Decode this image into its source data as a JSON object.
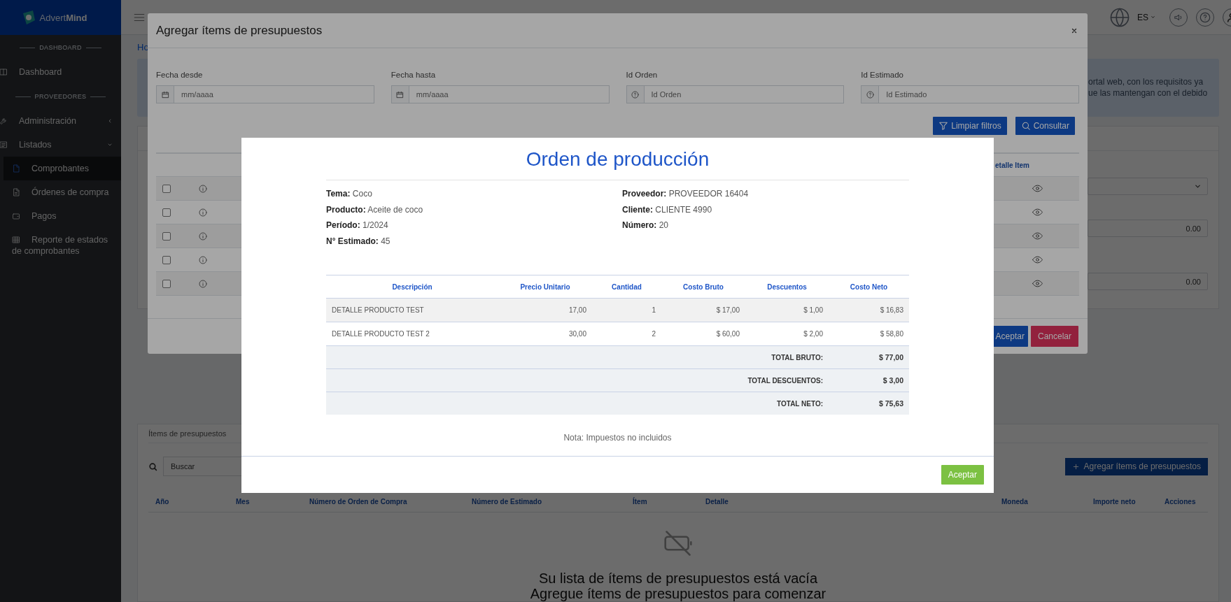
{
  "sidebar": {
    "logo": "Advert**Mind**",
    "items": [
      {
        "kind": "section",
        "label": "DASHBOARD"
      },
      {
        "kind": "link",
        "label": "Dashboard",
        "selected": false
      },
      {
        "kind": "section",
        "label": "PROVEEDORES"
      },
      {
        "kind": "group",
        "label": "Administración",
        "expanded": false
      },
      {
        "kind": "group",
        "label": "Listados",
        "expanded": true,
        "children": [
          {
            "label": "Comprobantes",
            "selected": true
          },
          {
            "label": "Órdenes de compra",
            "selected": false
          },
          {
            "label": "Pagos",
            "selected": false
          },
          {
            "label": "Reporte de estados de comprobantes",
            "selected": false
          }
        ]
      }
    ]
  },
  "topbar": {
    "language": "ES"
  },
  "breadcrumb": "Ho",
  "notice": {
    "lines": [
      "ortal web, con los requisitos ya",
      "ue las mantengan con el debido"
    ]
  },
  "form_card": {
    "fields": [
      {
        "kind": "select"
      },
      {
        "kind": "number",
        "value": "0.00"
      },
      {
        "kind": "number",
        "value": "0.00"
      }
    ]
  },
  "items_card": {
    "title": "Ítems de presupuestos",
    "search": {
      "placeholder": "Buscar"
    },
    "add_button": "Agregar ítems de presupuestos",
    "columns": [
      "Año",
      "Mes",
      "Número de Orden de Compra",
      "Número de Estimado",
      "Ítem",
      "Detalle",
      "Moneda",
      "Importe neto",
      "Acciones"
    ],
    "empty_state": {
      "title": "Su lista de ítems de presupuestos está vacía",
      "subtitle": "Agregue ítems de presupuestos para comenzar"
    }
  },
  "add_items_dialog": {
    "title": "Agregar ítems de presupuestos",
    "filters": [
      {
        "kind": "date",
        "label": "Fecha desde",
        "placeholder": "mm/aaaa"
      },
      {
        "kind": "date",
        "label": "Fecha hasta",
        "placeholder": "mm/aaaa"
      },
      {
        "kind": "id",
        "label": "Id Orden",
        "placeholder": "Id Orden"
      },
      {
        "kind": "id",
        "label": "Id Estimado",
        "placeholder": "Id Estimado"
      }
    ],
    "buttons": [
      {
        "kind": "clear",
        "label": "Limpiar filtros"
      },
      {
        "kind": "search",
        "label": "Consultar"
      }
    ],
    "table": {
      "header": "etalle Item",
      "rows": [
        {
          "checked": false
        },
        {
          "checked": false
        },
        {
          "checked": false
        },
        {
          "checked": false
        },
        {
          "checked": false
        }
      ]
    },
    "footer_buttons": [
      {
        "kind": "primary",
        "label": "Aceptar"
      },
      {
        "kind": "danger",
        "label": "Cancelar"
      }
    ]
  },
  "production_order_dialog": {
    "title": "Orden de producción",
    "details_left": [
      "**Tema:** Coco",
      "**Producto:** Aceite de coco",
      "**Período:** 1/2024",
      "**N° Estimado:** 45"
    ],
    "details_right": [
      "**Proveedor:** PROVEEDOR 16404",
      "**Cliente:** CLIENTE 4990",
      "**Número:** 20"
    ],
    "table": {
      "columns": [
        "Descripción",
        "Precio Unitario",
        "Cantidad",
        "Costo Bruto",
        "Descuentos",
        "Costo Neto"
      ],
      "rows": [
        [
          "DETALLE PRODUCTO TEST",
          "17,00",
          "1",
          "$ 17,00",
          "$ 1,00",
          "$ 16,83"
        ],
        [
          "DETALLE PRODUCTO TEST 2",
          "30,00",
          "2",
          "$ 60,00",
          "$ 2,00",
          "$ 58,80"
        ]
      ],
      "totals": [
        {
          "label": "TOTAL BRUTO:",
          "value": "$ 77,00"
        },
        {
          "label": "TOTAL DESCUENTOS:",
          "value": "$ 3,00"
        },
        {
          "label": "TOTAL NETO:",
          "value": "$ 75,63"
        }
      ]
    },
    "note": "Nota: Impuestos no incluidos",
    "button": "Aceptar"
  }
}
